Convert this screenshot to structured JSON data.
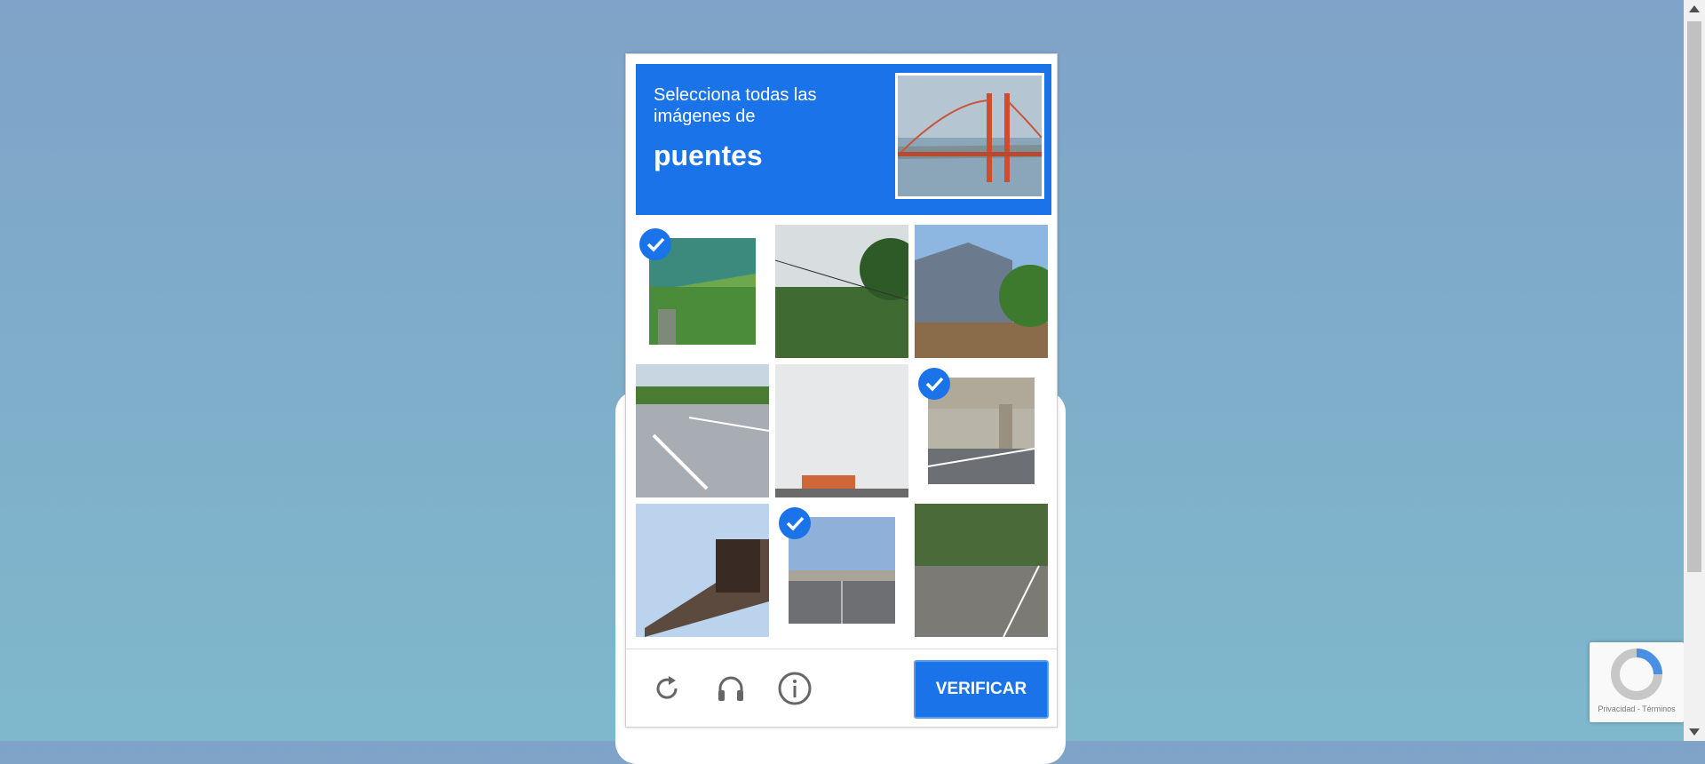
{
  "challenge": {
    "instruction_line1": "Selecciona todas las imágenes de",
    "instruction_keyword": "puentes",
    "sample_image": "golden-gate-bridge",
    "tiles": [
      {
        "name": "bridge-underside",
        "selected": true
      },
      {
        "name": "trees-wires",
        "selected": false
      },
      {
        "name": "barn-building",
        "selected": false
      },
      {
        "name": "highway-road",
        "selected": false
      },
      {
        "name": "cloudy-sky-building",
        "selected": false
      },
      {
        "name": "overpass-curve",
        "selected": true
      },
      {
        "name": "sign-gantry",
        "selected": false
      },
      {
        "name": "overpass-highway",
        "selected": true
      },
      {
        "name": "rural-road",
        "selected": false
      }
    ],
    "verify_label": "VERIFICAR",
    "icons": [
      "reload-icon",
      "audio-icon",
      "info-icon"
    ]
  },
  "badge": {
    "text": "Privacidad - Términos"
  },
  "colors": {
    "accent": "#1a73e8",
    "background_top": "#7fa3c8",
    "background_bottom": "#7fb8cc"
  }
}
